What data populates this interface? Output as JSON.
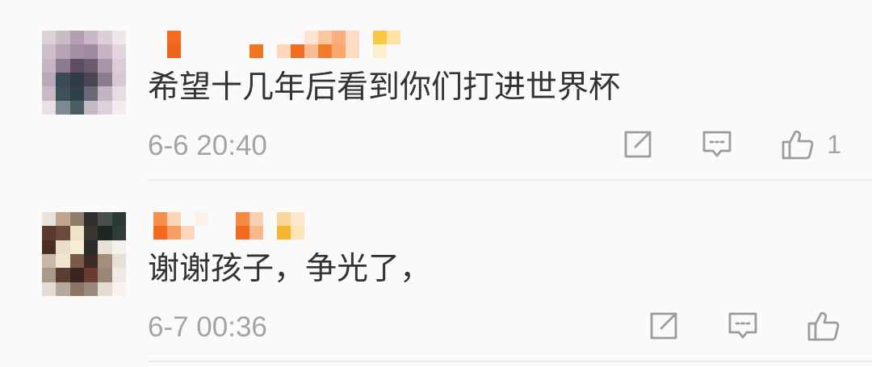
{
  "colors": {
    "background": "#fafafa",
    "text": "#333333",
    "meta": "#a4a4a4",
    "icon": "#9c9c9c",
    "divider": "#e9e9e9"
  },
  "comments": [
    {
      "avatar_mosaic": [
        [
          "#d9d2d6",
          "#c8bcc5",
          "#b39fb0",
          "#c9b6c6",
          "#dcd0d8",
          "#ede6ea"
        ],
        [
          "#cdbfc9",
          "#b7a3b4",
          "#a58ea3",
          "#9d8aa1",
          "#c7b3c4",
          "#e2d7de"
        ],
        [
          "#c6b6c3",
          "#8e7a8f",
          "#5e4e62",
          "#6a5a6e",
          "#a896a8",
          "#d9cdd6"
        ],
        [
          "#b9a8b7",
          "#3c4a55",
          "#2e3b46",
          "#4a4752",
          "#8a7d8e",
          "#d6c9d2"
        ],
        [
          "#c9b9c5",
          "#3d5058",
          "#2f404a",
          "#6b6876",
          "#c4b4c2",
          "#e6dde3"
        ],
        [
          "#e8e0e5",
          "#7b8a91",
          "#4b5c64",
          "#c5b8c3",
          "#ddd1d9",
          "#f2ecf0"
        ]
      ],
      "username_mosaic": [
        [
          null,
          "#f26b1f",
          null,
          null,
          null,
          null,
          null,
          null,
          null,
          null,
          null,
          "#fde4d2",
          "#fbc6a0",
          "#f8ae7e",
          "#fcdcc4",
          null,
          "#fbc642",
          "#fde4a6"
        ],
        [
          null,
          "#f0631a",
          null,
          null,
          null,
          null,
          null,
          "#f27524",
          null,
          "#fcd5bb",
          "#f26e22",
          "#f9bc92",
          "#f37b2c",
          "#f8a86a",
          "#fcdcc2",
          null,
          "#fff0cc",
          null
        ]
      ],
      "text": "希望十几年后看到你们打进世界杯",
      "timestamp": "6-6 20:40",
      "actions": {
        "share_icon": "share-icon",
        "comment_icon": "comment-icon",
        "like_icon": "thumbs-up-icon",
        "like_count": "1"
      }
    },
    {
      "avatar_mosaic": [
        [
          "#e9e3dc",
          "#bfa58c",
          "#8f7d6b",
          "#2f3130",
          "#4a4f4a",
          "#2c3a36"
        ],
        [
          "#5a3a2e",
          "#6b4a3a",
          "#ece3c8",
          "#3b3530",
          "#1f2622",
          "#2f3d38"
        ],
        [
          "#4a2e25",
          "#e9dfc9",
          "#f4ecd6",
          "#2a2a28",
          "#e8e2d2",
          "#f4f1ea"
        ],
        [
          "#c7b9a6",
          "#f0e6d0",
          "#7a5a48",
          "#3c2a24",
          "#a58d7a",
          "#e8e0d6"
        ],
        [
          "#a7998c",
          "#5b3d33",
          "#3b2420",
          "#6b3a30",
          "#9a8678",
          "#efe9e3"
        ],
        [
          "#e5ddd5",
          "#b5a89c",
          "#8d7565",
          "#9a8a7e",
          "#e4dbd2",
          "#f6f3ef"
        ]
      ],
      "username_mosaic": [
        [
          "#f7904a",
          "#fbd3b6",
          null,
          "#fdf2ea",
          null,
          null,
          "#f58a44",
          "#fbd0b2",
          null,
          "#fad59a",
          "#fde8cc"
        ],
        [
          "#f36a1f",
          "#f89d66",
          "#fcd5bb",
          null,
          null,
          null,
          "#f26a1f",
          "#f9b98f",
          null,
          "#f5b530",
          "#fce3b8"
        ]
      ],
      "text": "谢谢孩子，争光了，",
      "timestamp": "6-7 00:36",
      "actions": {
        "share_icon": "share-icon",
        "comment_icon": "comment-icon",
        "like_icon": "thumbs-up-icon"
      }
    }
  ]
}
